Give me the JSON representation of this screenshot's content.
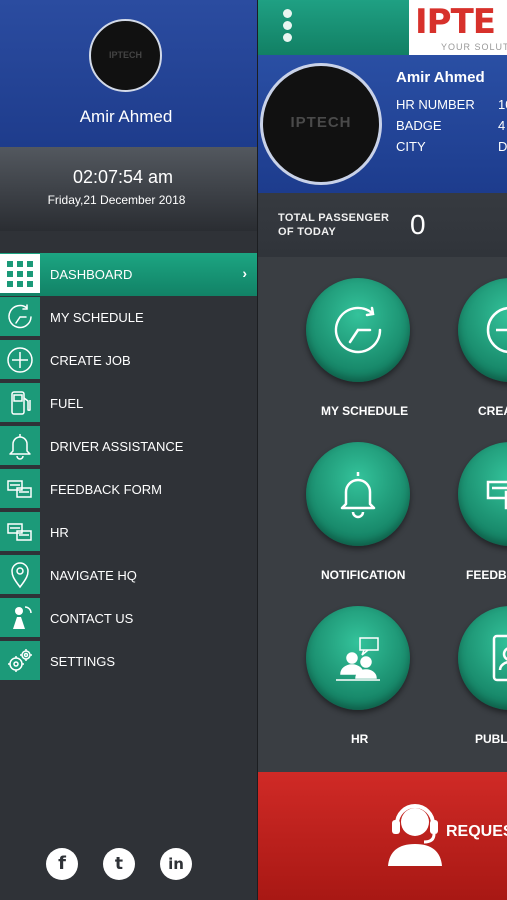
{
  "drawer": {
    "user_name": "Amir Ahmed",
    "avatar_text": "IPTECH",
    "clock": {
      "time": "02:07:54 am",
      "date": "Friday,21 December 2018"
    },
    "menu": [
      {
        "label": "DASHBOARD",
        "icon": "grid-icon",
        "active": true
      },
      {
        "label": "MY SCHEDULE",
        "icon": "clock-icon"
      },
      {
        "label": "CREATE JOB",
        "icon": "plus-circle-icon"
      },
      {
        "label": "FUEL",
        "icon": "fuel-pump-icon"
      },
      {
        "label": "DRIVER ASSISTANCE",
        "icon": "bell-icon"
      },
      {
        "label": "FEEDBACK FORM",
        "icon": "feedback-icon"
      },
      {
        "label": "HR",
        "icon": "hr-icon"
      },
      {
        "label": "NAVIGATE HQ",
        "icon": "map-pin-icon"
      },
      {
        "label": "CONTACT US",
        "icon": "phone-contact-icon"
      },
      {
        "label": "SETTINGS",
        "icon": "gears-icon"
      }
    ],
    "social": [
      {
        "label": "f",
        "icon": "facebook-icon"
      },
      {
        "label": "t",
        "icon": "twitter-icon"
      },
      {
        "label": "in",
        "icon": "linkedin-icon"
      }
    ]
  },
  "main": {
    "logo": {
      "text": "IPTE",
      "tagline": "YOUR SOLUT"
    },
    "profile": {
      "name": "Amir Ahmed",
      "avatar_text": "IPTECH",
      "rows": [
        {
          "label": "HR NUMBER",
          "value": "10"
        },
        {
          "label": "BADGE",
          "value": "4"
        },
        {
          "label": "CITY",
          "value": "D"
        }
      ]
    },
    "stats": {
      "label": "TOTAL PASSENGER OF TODAY",
      "count": "0"
    },
    "tiles": [
      {
        "label": "MY SCHEDULE",
        "icon": "clock-icon"
      },
      {
        "label": "CREAT",
        "icon": "plus-circle-icon"
      },
      {
        "label": "NOTIFICATION",
        "icon": "bell-icon"
      },
      {
        "label": "FEEDBA",
        "icon": "feedback-icon"
      },
      {
        "label": "HR",
        "icon": "hr-icon"
      },
      {
        "label": "PUBLI",
        "icon": "tablet-icon"
      }
    ],
    "request": {
      "label": "REQUES",
      "icon": "headset-agent-icon"
    }
  },
  "colors": {
    "accent": "#1c9a79",
    "header_blue": "#2a4fa4",
    "request_red": "#c9231f"
  }
}
